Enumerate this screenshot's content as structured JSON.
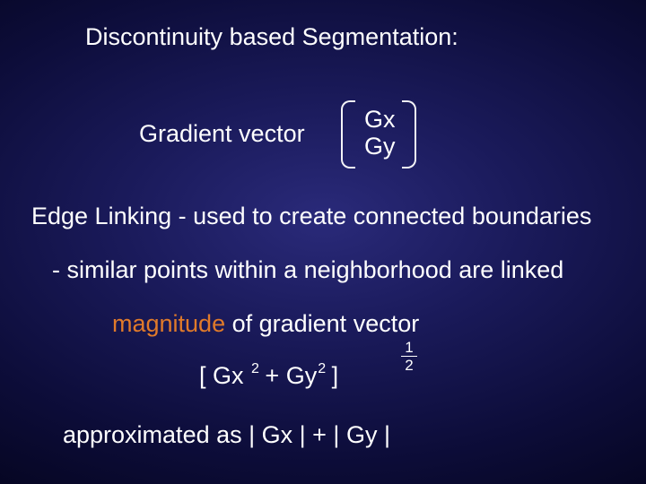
{
  "title": "Discontinuity based Segmentation:",
  "gradient_label": "Gradient vector",
  "gradient": {
    "x": "Gx",
    "y": "Gy"
  },
  "edge_linking": "Edge Linking - used to create connected boundaries",
  "similar_points": "- similar points within a neighborhood are linked",
  "magnitude": {
    "word": "magnitude",
    "rest": " of gradient vector"
  },
  "formula": {
    "lbr": "[ Gx ",
    "exp1": "2",
    "mid": " + Gy",
    "exp2": "2",
    "rbr": " ]",
    "outer_num": "1",
    "outer_den": "2"
  },
  "approx": {
    "label": "approximated as   ",
    "expr": "| Gx | + | Gy |"
  }
}
